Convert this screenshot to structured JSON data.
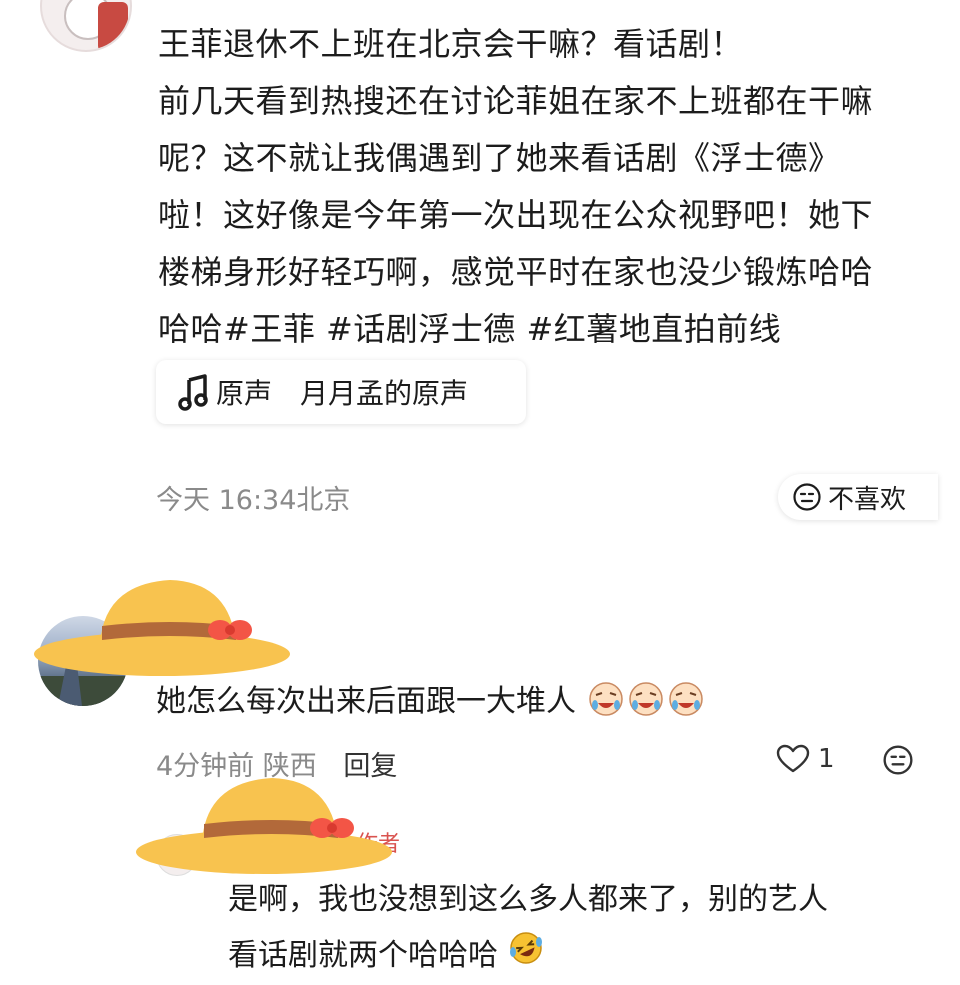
{
  "post": {
    "lines": [
      "王菲退休不上班在北京会干嘛？看话剧！",
      "前几天看到热搜还在讨论菲姐在家不上班都在干嘛",
      "呢？这不就让我偶遇到了她来看话剧《浮士德》",
      "啦！这好像是今年第一次出现在公众视野吧！她下",
      "楼梯身形好轻巧啊，感觉平时在家也没少锻炼哈哈",
      "哈哈#王菲 #话剧浮士德 #红薯地直拍前线"
    ],
    "sound": {
      "type": "原声",
      "name": "月月孟的原声",
      "icon": "music-note-icon"
    },
    "time_location": "今天 16:34北京",
    "dislike_label": "不喜欢"
  },
  "comment": {
    "text": "她怎么每次出来后面跟一大堆人",
    "time_location": "4分钟前 陕西",
    "reply_label": "回复",
    "like_count": "1",
    "emoji": "laughing-crying-baby-emoji"
  },
  "reply": {
    "author_tag": "作者",
    "lines": [
      "是啊，我也没想到这么多人都来了，别的艺人",
      "看话剧就两个哈哈哈"
    ],
    "emoji": "rolling-laughing-emoji"
  },
  "colors": {
    "hat_yellow": "#f8c34f",
    "hat_band": "#b2693a",
    "bow_red": "#f35546",
    "meta_gray": "#8a8a8a",
    "author_red": "#d9534f"
  }
}
